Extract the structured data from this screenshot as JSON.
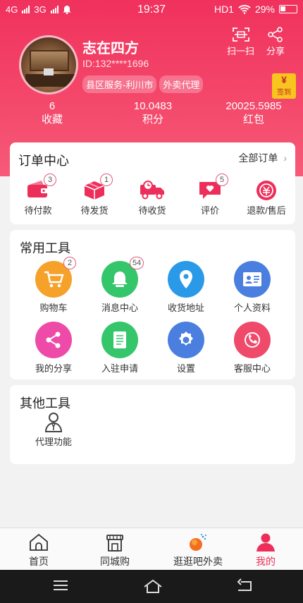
{
  "status": {
    "net1": "4G",
    "net2": "3G",
    "time": "19:37",
    "hd": "HD1",
    "battery": "29%"
  },
  "profile": {
    "name": "志在四方",
    "id": "ID:132****1696",
    "tags": [
      "县区服务-利川市",
      "外卖代理"
    ]
  },
  "header_actions": {
    "scan": "扫一扫",
    "share": "分享",
    "signin": "签到",
    "signin_symbol": "¥"
  },
  "stats": [
    {
      "value": "6",
      "label": "收藏"
    },
    {
      "value": "10.0483",
      "label": "积分"
    },
    {
      "value": "20025.5985",
      "label": "红包"
    }
  ],
  "orders": {
    "title": "订单中心",
    "all": "全部订单",
    "items": [
      {
        "label": "待付款",
        "badge": "3",
        "icon": "wallet-icon"
      },
      {
        "label": "待发货",
        "badge": "1",
        "icon": "box-icon"
      },
      {
        "label": "待收货",
        "badge": "",
        "icon": "truck-icon"
      },
      {
        "label": "评价",
        "badge": "5",
        "icon": "heart-chat-icon"
      },
      {
        "label": "退款/售后",
        "badge": "",
        "icon": "refund-icon"
      }
    ]
  },
  "tools": {
    "title": "常用工具",
    "items": [
      {
        "label": "购物车",
        "badge": "2",
        "icon": "cart-icon",
        "color": "#f5a12a"
      },
      {
        "label": "消息中心",
        "badge": "54",
        "icon": "bell-icon",
        "color": "#35c56a"
      },
      {
        "label": "收货地址",
        "badge": "",
        "icon": "location-icon",
        "color": "#2a9ae8"
      },
      {
        "label": "个人资料",
        "badge": "",
        "icon": "id-card-icon",
        "color": "#4a7fe0"
      },
      {
        "label": "我的分享",
        "badge": "",
        "icon": "share-icon",
        "color": "#ee4aa8"
      },
      {
        "label": "入驻申请",
        "badge": "",
        "icon": "document-icon",
        "color": "#35c56a"
      },
      {
        "label": "设置",
        "badge": "",
        "icon": "gear-icon",
        "color": "#4a7fe0"
      },
      {
        "label": "客服中心",
        "badge": "",
        "icon": "phone-icon",
        "color": "#ef4a6a"
      }
    ]
  },
  "other_tools": {
    "title": "其他工具",
    "items": [
      {
        "label": "代理功能",
        "icon": "agent-icon"
      }
    ]
  },
  "tabbar": [
    {
      "label": "首页",
      "icon": "home-icon",
      "active": false
    },
    {
      "label": "同城购",
      "icon": "store-icon",
      "active": false
    },
    {
      "label": "逛逛吧外卖",
      "icon": "takeout-icon",
      "active": false
    },
    {
      "label": "我的",
      "icon": "user-icon",
      "active": true
    }
  ],
  "colors": {
    "brand": "#ee2e5a",
    "background": "#f2f2f2"
  }
}
